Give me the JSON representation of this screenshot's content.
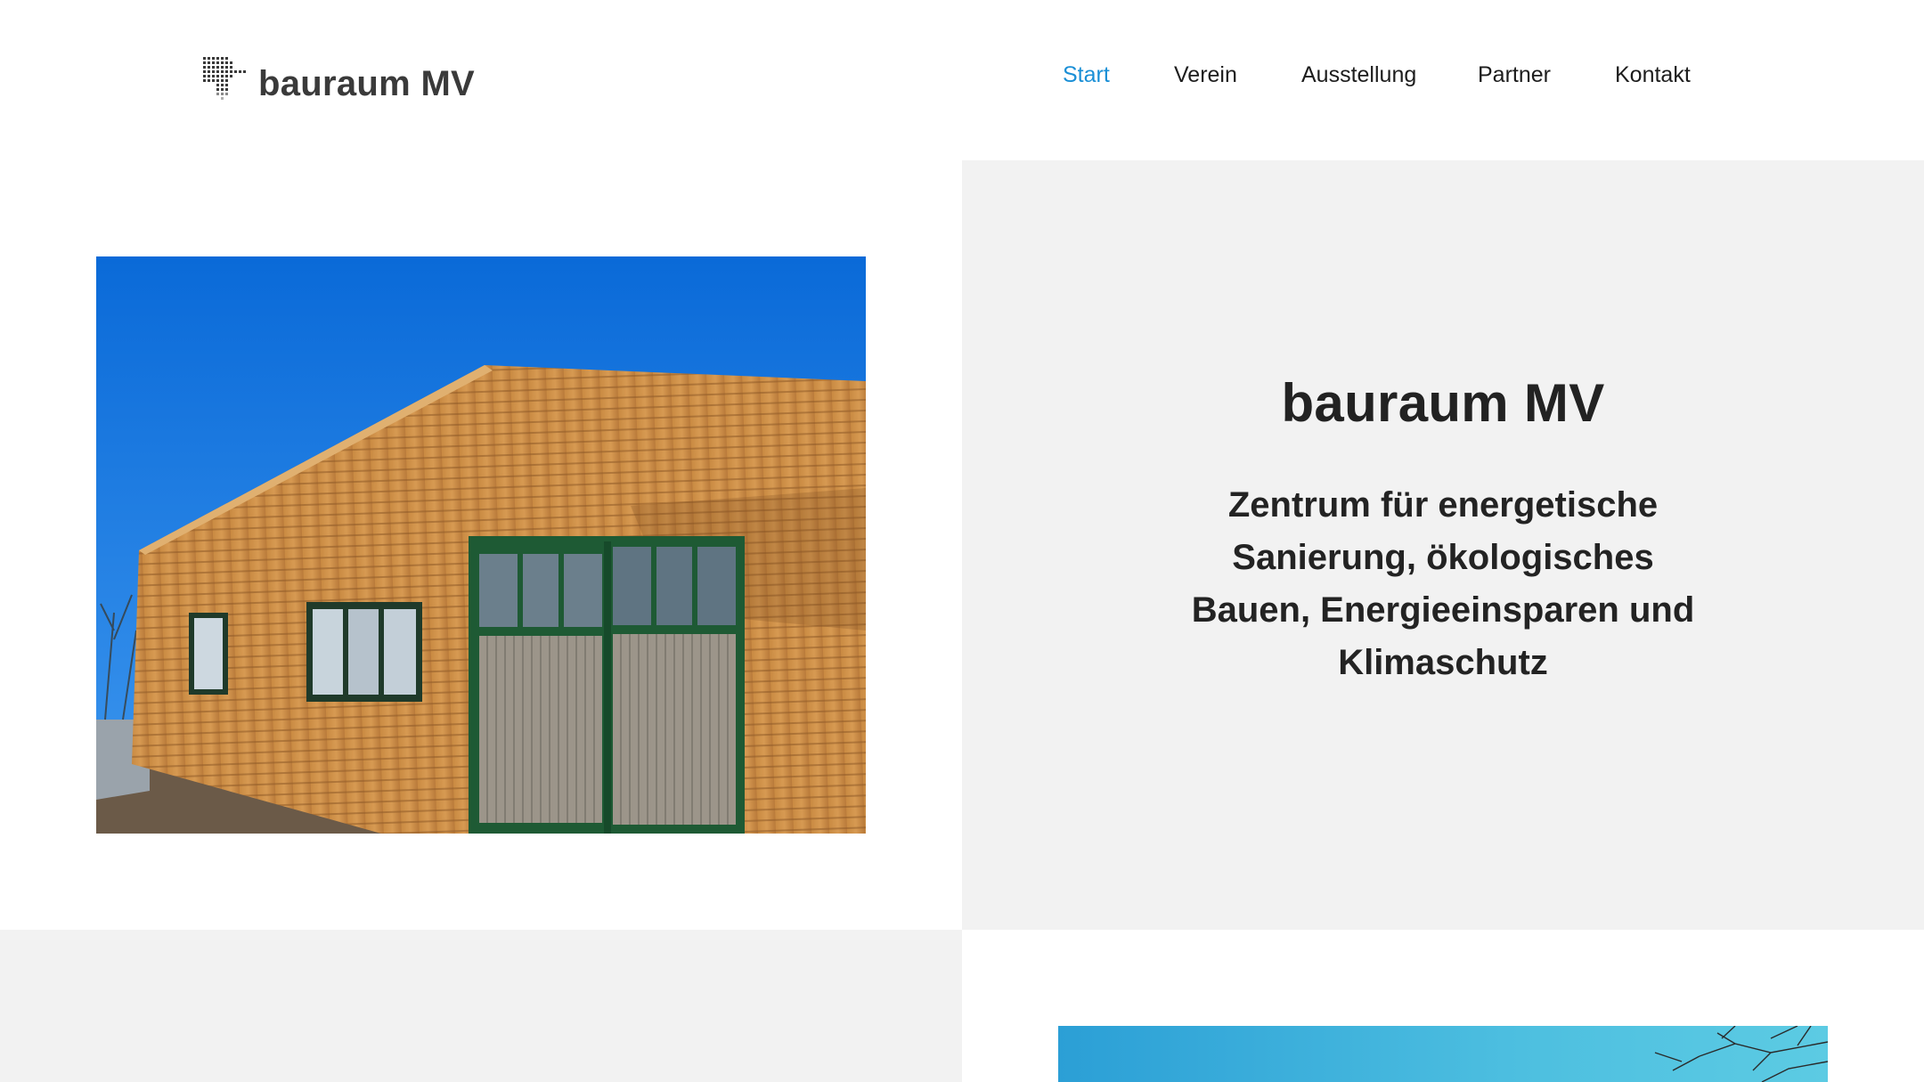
{
  "site": {
    "logo_text": "bauraum MV"
  },
  "nav": {
    "items": [
      {
        "label": "Start",
        "active": true
      },
      {
        "label": "Verein",
        "active": false
      },
      {
        "label": "Ausstellung",
        "active": false
      },
      {
        "label": "Partner",
        "active": false
      },
      {
        "label": "Kontakt",
        "active": false
      }
    ]
  },
  "hero": {
    "title": "bauraum MV",
    "subtitle": "Zentrum für energetische Sanierung, ökologisches Bauen, Energieeinsparen und Klimaschutz"
  },
  "colors": {
    "accent": "#1a8fd6",
    "panel": "#f2f2f2",
    "text": "#222222"
  }
}
